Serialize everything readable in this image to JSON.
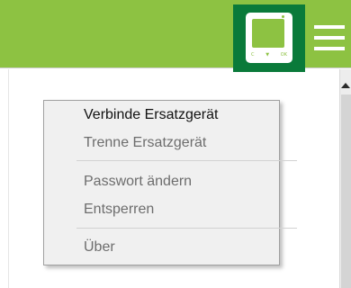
{
  "colors": {
    "header_green": "#8dc242",
    "device_button": "#0a7a3a",
    "menu_background": "#f0f0f0"
  },
  "header": {
    "device_icon": "thermostat-device-icon",
    "device_keys": [
      "C",
      "▼",
      "OK"
    ],
    "menu_icon": "hamburger-menu-icon"
  },
  "context_menu": {
    "items": [
      {
        "label": "Verbinde Ersatzgerät",
        "enabled": true
      },
      {
        "label": "Trenne Ersatzgerät",
        "enabled": false
      },
      {
        "label": "Passwort ändern",
        "enabled": false
      },
      {
        "label": "Entsperren",
        "enabled": false
      },
      {
        "label": "Über",
        "enabled": false
      }
    ]
  }
}
